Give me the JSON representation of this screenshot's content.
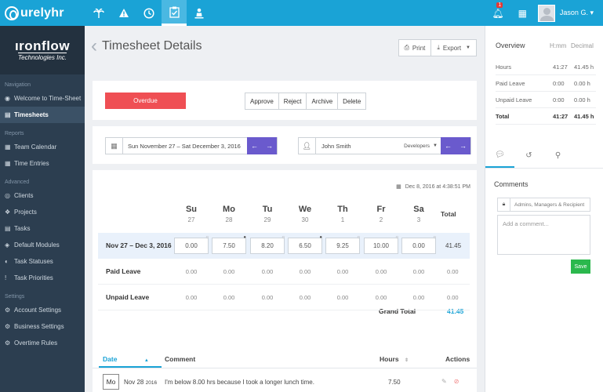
{
  "topbar": {
    "brand": "urelyhr",
    "nav_icons": [
      "palm-tree-icon",
      "warning-icon",
      "clock-icon",
      "clipboard-check-icon",
      "person-pin-icon"
    ],
    "notification_count": "1",
    "username": "Jason G.",
    "user_caret": "▾"
  },
  "sidebar": {
    "brand_name": "ıronflow",
    "brand_sub": "Technologies Inc.",
    "sections": [
      {
        "title": "Navigation",
        "items": [
          {
            "label": "Welcome to Time-Sheet",
            "icon": "dashboard-icon",
            "active": false
          },
          {
            "label": "Timesheets",
            "icon": "list-icon",
            "active": true
          }
        ]
      },
      {
        "title": "Reports",
        "items": [
          {
            "label": "Team Calendar",
            "icon": "calendar-icon",
            "active": false
          },
          {
            "label": "Time Entries",
            "icon": "calendar-icon",
            "active": false
          }
        ]
      },
      {
        "title": "Advanced",
        "items": [
          {
            "label": "Clients",
            "icon": "user-circle-icon",
            "active": false
          },
          {
            "label": "Projects",
            "icon": "cubes-icon",
            "active": false
          },
          {
            "label": "Tasks",
            "icon": "list-icon",
            "active": false
          },
          {
            "label": "Default Modules",
            "icon": "modules-icon",
            "active": false
          },
          {
            "label": "Task Statuses",
            "icon": "status-icon",
            "active": false
          },
          {
            "label": "Task Priorities",
            "icon": "exclamation-icon",
            "active": false
          }
        ]
      },
      {
        "title": "Settings",
        "items": [
          {
            "label": "Account Settings",
            "icon": "gear-icon",
            "active": false
          },
          {
            "label": "Business Settings",
            "icon": "gear-icon",
            "active": false
          },
          {
            "label": "Overtime Rules",
            "icon": "gear-icon",
            "active": false
          }
        ]
      }
    ]
  },
  "header": {
    "title": "Timesheet Details",
    "print_label": "Print",
    "export_label": "Export"
  },
  "status": {
    "badge": "Overdue",
    "actions": [
      "Approve",
      "Reject",
      "Archive",
      "Delete"
    ]
  },
  "filters": {
    "date_range": "Sun November 27 – Sat December 3, 2016",
    "employee": "John Smith",
    "department": "Developers"
  },
  "grid": {
    "stamp": "Dec 8, 2016 at 4:38:51 PM",
    "days": [
      {
        "name": "Su",
        "num": "27"
      },
      {
        "name": "Mo",
        "num": "28"
      },
      {
        "name": "Tu",
        "num": "29"
      },
      {
        "name": "We",
        "num": "30"
      },
      {
        "name": "Th",
        "num": "1"
      },
      {
        "name": "Fr",
        "num": "2"
      },
      {
        "name": "Sa",
        "num": "3"
      }
    ],
    "total_header": "Total",
    "week_label": "Nov 27 – Dec 3, 2016",
    "week_hours": [
      {
        "value": "0.00",
        "comment": false
      },
      {
        "value": "7.50",
        "comment": true
      },
      {
        "value": "8.20",
        "comment": false
      },
      {
        "value": "6.50",
        "comment": true
      },
      {
        "value": "9.25",
        "comment": false
      },
      {
        "value": "10.00",
        "comment": false
      },
      {
        "value": "0.00",
        "comment": false
      }
    ],
    "week_total": "41.45",
    "rows": [
      {
        "label": "Paid Leave",
        "values": [
          "0.00",
          "0.00",
          "0.00",
          "0.00",
          "0.00",
          "0.00",
          "0.00"
        ],
        "total": "0.00"
      },
      {
        "label": "Unpaid Leave",
        "values": [
          "0.00",
          "0.00",
          "0.00",
          "0.00",
          "0.00",
          "0.00",
          "0.00"
        ],
        "total": "0.00"
      }
    ],
    "grand_total_label": "Grand Total",
    "grand_total_value": "41.45"
  },
  "comments_table": {
    "headers": {
      "date": "Date",
      "comment": "Comment",
      "hours": "Hours",
      "actions": "Actions"
    },
    "rows": [
      {
        "day": "Mo",
        "date_main": "Nov 28",
        "date_year": "2016",
        "comment": "I'm below 8.00 hrs because I took a longer lunch time.",
        "hours": "7.50"
      }
    ]
  },
  "overview": {
    "title": "Overview",
    "col_hmm": "H:mm",
    "col_decimal": "Decimal",
    "rows": [
      {
        "label": "Hours",
        "hmm": "41:27",
        "decimal": "41.45 h",
        "bold": false
      },
      {
        "label": "Paid Leave",
        "hmm": "0:00",
        "decimal": "0.00 h",
        "bold": false
      },
      {
        "label": "Unpaid Leave",
        "hmm": "0:00",
        "decimal": "0.00 h",
        "bold": false
      },
      {
        "label": "Total",
        "hmm": "41:27",
        "decimal": "41.45 h",
        "bold": true
      }
    ]
  },
  "comments_panel": {
    "title": "Comments",
    "visibility": "Admins, Managers & Recipient",
    "placeholder": "Add a comment...",
    "save_label": "Save"
  },
  "colors": {
    "topbar": "#1aa3d6",
    "sidebar": "#2c3e50",
    "overdue": "#ef4f54",
    "nav_button": "#6a5acd",
    "save": "#2bb84d",
    "accent": "#1aa3d6"
  }
}
